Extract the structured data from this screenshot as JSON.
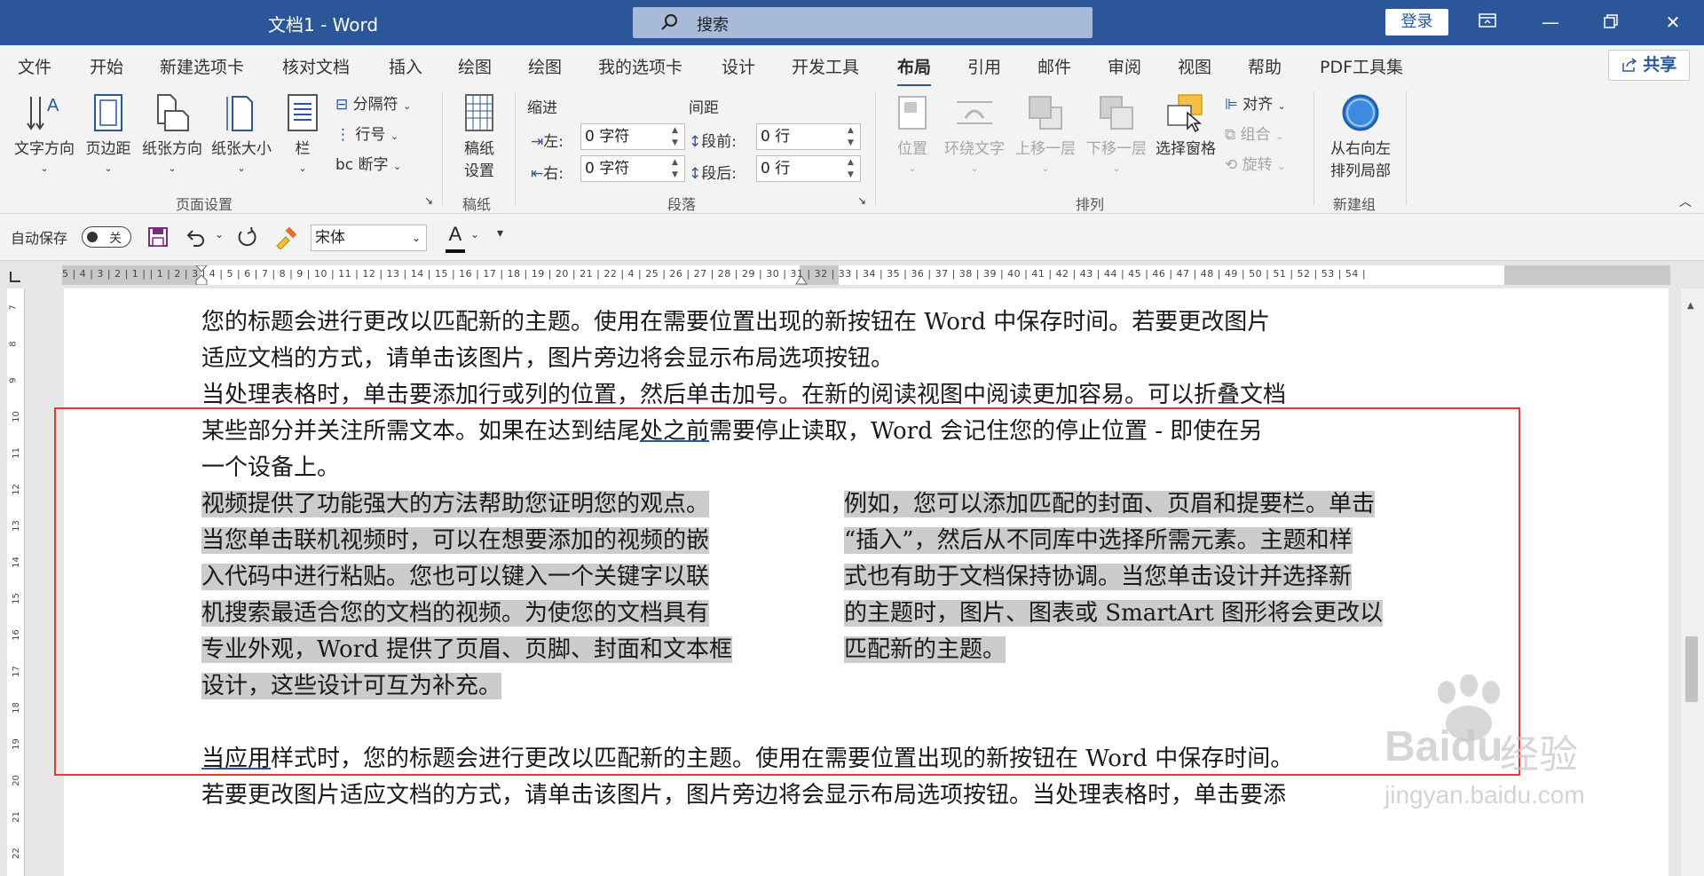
{
  "titlebar": {
    "doc_title": "文档1  -  Word",
    "search_placeholder": "搜索",
    "login_label": "登录",
    "window_buttons": [
      "restore-ribbon-icon",
      "minimize-icon",
      "maximize-icon",
      "close-icon"
    ]
  },
  "menu": {
    "tabs": [
      "文件",
      "开始",
      "新建选项卡",
      "核对文档",
      "插入",
      "绘图",
      "绘图",
      "我的选项卡",
      "设计",
      "开发工具",
      "布局",
      "引用",
      "邮件",
      "审阅",
      "视图",
      "帮助",
      "PDF工具集"
    ],
    "active_tab": "布局",
    "share_label": "共享"
  },
  "ribbon": {
    "page_setup": {
      "buttons": [
        "文字方向",
        "页边距",
        "纸张方向",
        "纸张大小",
        "栏"
      ],
      "small": [
        "分隔符",
        "行号",
        "断字"
      ],
      "label": "页面设置"
    },
    "draft": {
      "button_line1": "稿纸",
      "button_line2": "设置",
      "label": "稿纸"
    },
    "paragraph": {
      "indent_title": "缩进",
      "spacing_title": "间距",
      "left_label": "左:",
      "left_value": "0 字符",
      "right_label": "右:",
      "right_value": "0 字符",
      "before_label": "段前:",
      "before_value": "0 行",
      "after_label": "段后:",
      "after_value": "0 行",
      "label": "段落"
    },
    "arrange": {
      "buttons": [
        "位置",
        "环绕文字",
        "上移一层",
        "下移一层",
        "选择窗格"
      ],
      "small": [
        "对齐",
        "组合",
        "旋转"
      ],
      "label": "排列"
    },
    "new_group": {
      "button_line1": "从右向左",
      "button_line2": "排列局部",
      "label": "新建组"
    }
  },
  "qat": {
    "autosave_label": "自动保存",
    "toggle_label": "关",
    "font_name": "宋体"
  },
  "ruler": {
    "numbers": "5  |  4  |  3  |  2  |  1  |        |  1  |  2  |  3  |  4  |  5  |  6  |  7  |  8  |  9  |  10  |  11  |  12  |  13  |  14  |  15  |  16  |  17  |  18  |  19  |  20  |  21  |  22  |            4  |  25  |  26  |  27  |  28  |  29  |  30  |  31  |  32  |  33  |  34  |  35  |  36  |  37  |  38  |  39  |  40  |  41  |  42  |  43  |  44  |  45  |  46  |  47  |  48  |  49  |  50  |  51  |  52  |  53  |  54  |",
    "vertical": [
      "7",
      "8",
      "9",
      "10",
      "11",
      "12",
      "13",
      "14",
      "15",
      "16",
      "17",
      "18",
      "19",
      "20",
      "21",
      "22"
    ]
  },
  "document": {
    "p1_line1": "您的标题会进行更改以匹配新的主题。使用在需要位置出现的新按钮在 Word 中保存时间。若要更改图片",
    "p1_line2": "适应文档的方式，请单击该图片，图片旁边将会显示布局选项按钮。",
    "p2_line1": "当处理表格时，单击要添加行或列的位置，然后单击加号。在新的阅读视图中阅读更加容易。可以折叠文档",
    "p2_line2_a": "某些部分并关注所需文本。如果在达到结尾",
    "p2_line2_ul": "处之前",
    "p2_line2_b": "需要停止读取，Word 会记住您的停止位置 - 即使在另",
    "p2_line3": "一个设备上。",
    "col1": [
      "视频提供了功能强大的方法帮助您证明您的观点。",
      "当您单击联机视频时，可以在想要添加的视频的嵌",
      "入代码中进行粘贴。您也可以键入一个关键字以联",
      "机搜索最适合您的文档的视频。为使您的文档具有",
      "专业外观，Word 提供了页眉、页脚、封面和文本框",
      "设计，这些设计可互为补充。"
    ],
    "col2": [
      "例如，您可以添加匹配的封面、页眉和提要栏。单击",
      "“插入”，然后从不同库中选择所需元素。主题和样",
      "式也有助于文档保持协调。当您单击设计并选择新",
      "的主题时，图片、图表或 SmartArt 图形将会更改以",
      "匹配新的主题。"
    ],
    "p3_line1_ul": "当应用",
    "p3_line1_b": "样式时，您的标题会进行更改以匹配新的主题。使用在需要位置出现的新按钮在 Word 中保存时间。",
    "p3_line2": "若要更改图片适应文档的方式，请单击该图片，图片旁边将会显示布局选项按钮。当处理表格时，单击要添"
  },
  "watermark": {
    "brand": "Baidu",
    "suffix": "经验",
    "url": "jingyan.baidu.com"
  },
  "colors": {
    "accent": "#2b579a",
    "highlight": "#cccccc",
    "annotation": "#e53935"
  }
}
